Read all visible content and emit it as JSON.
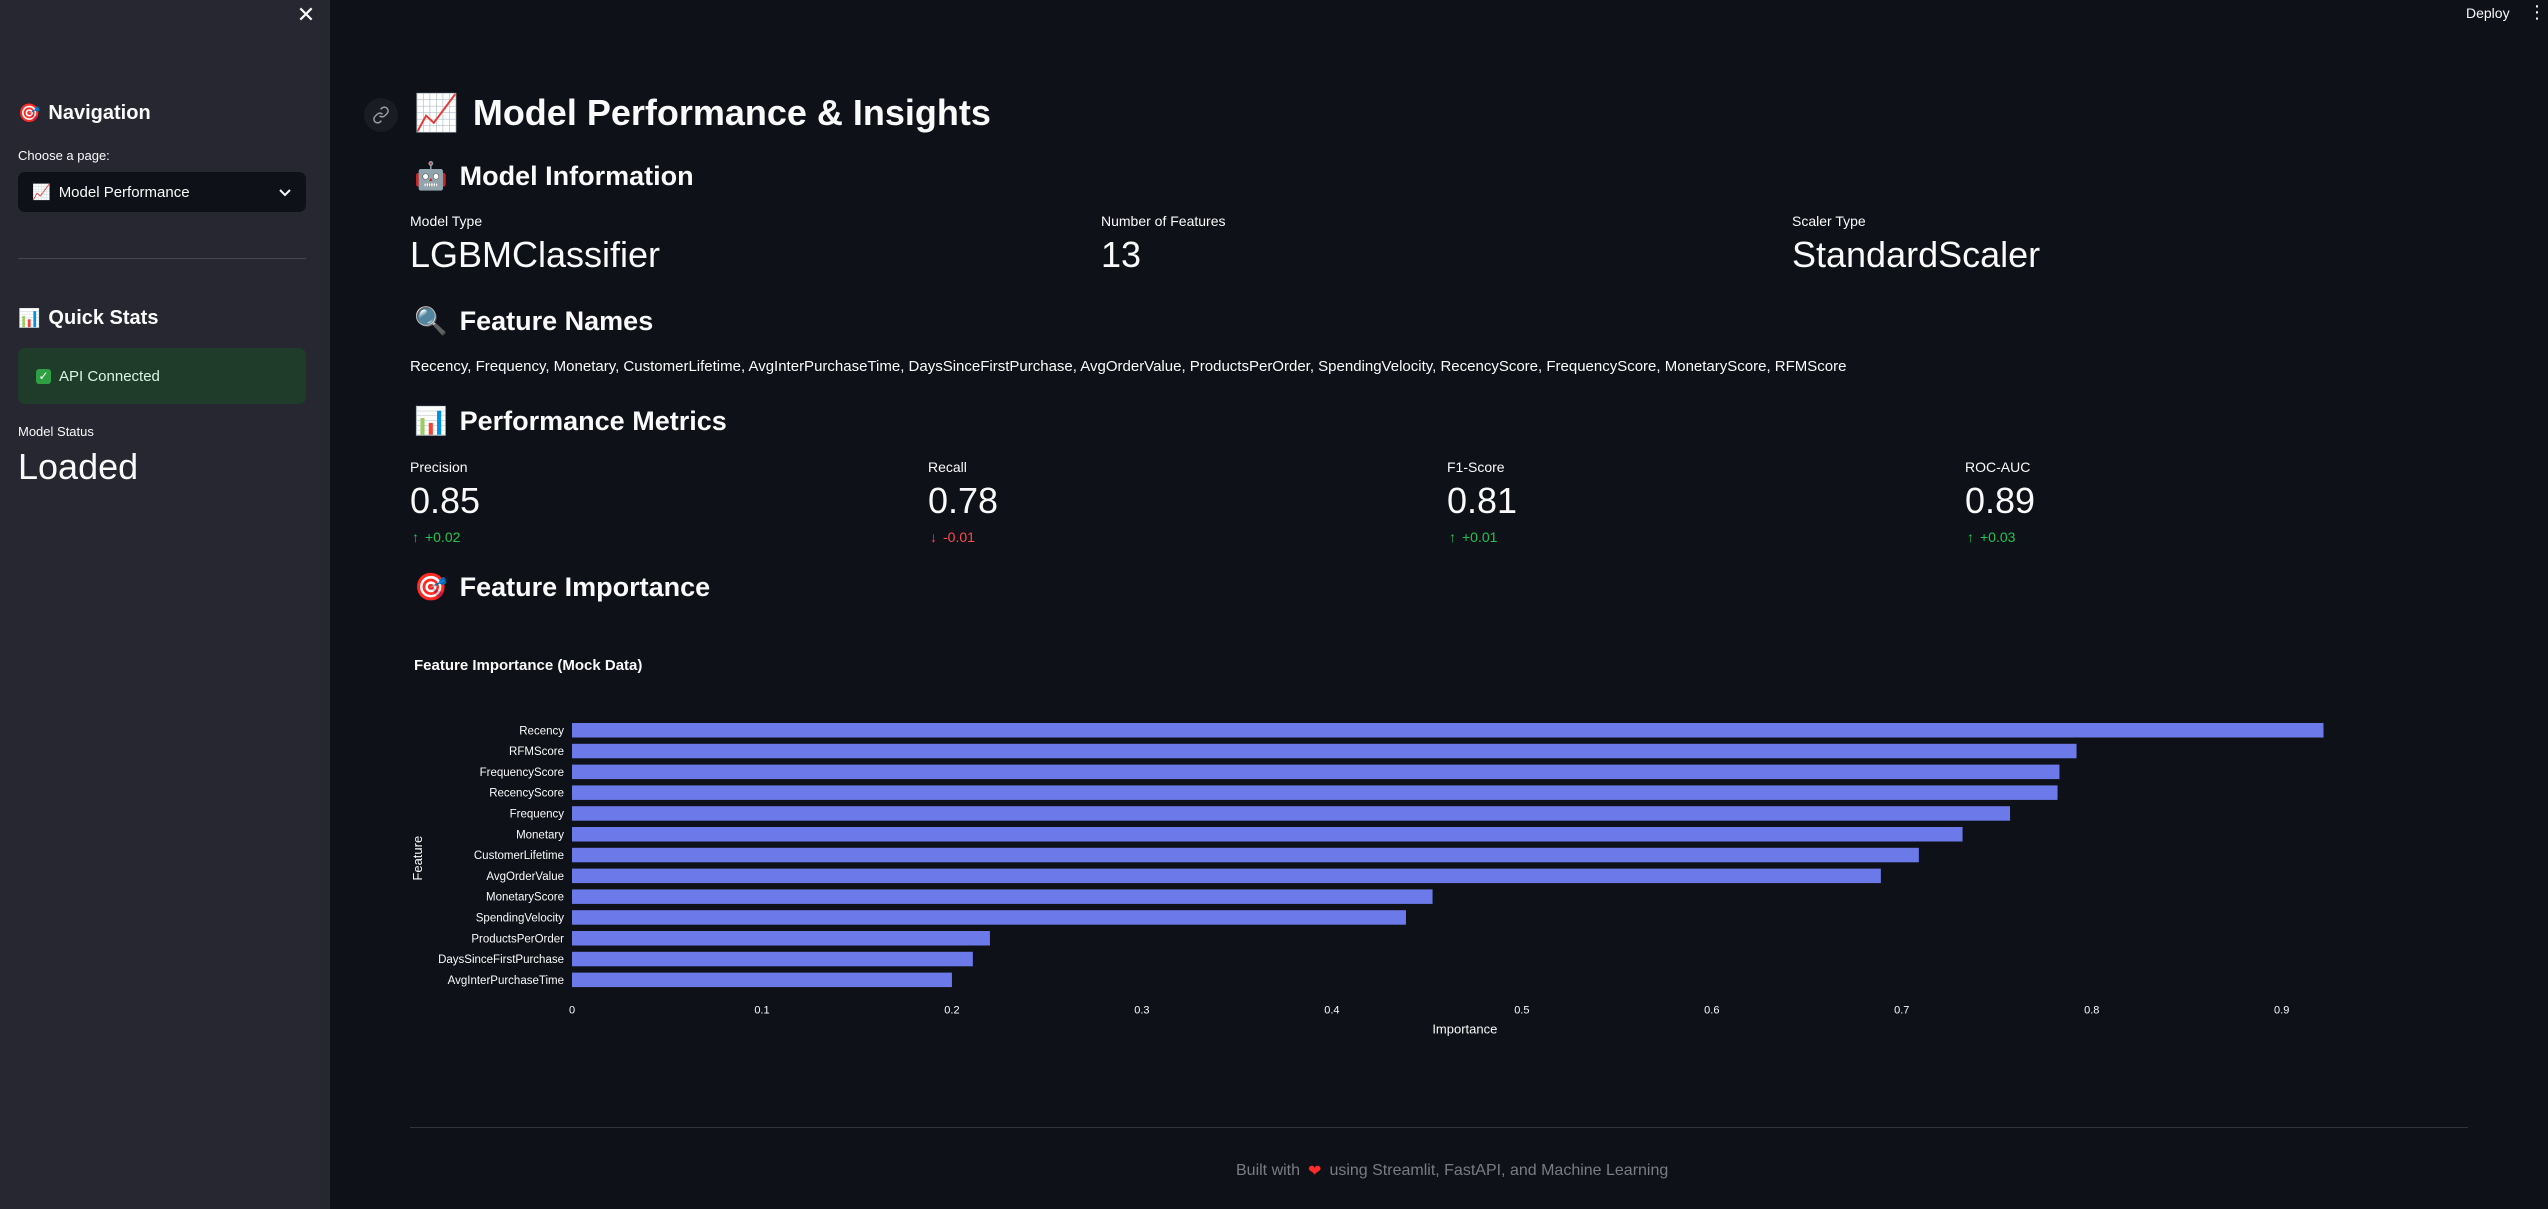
{
  "sidebar": {
    "navigation_title": "Navigation",
    "choose_label": "Choose a page:",
    "selected_page": "Model Performance",
    "quick_stats_title": "Quick Stats",
    "api_status": "API Connected",
    "model_status_label": "Model Status",
    "model_status_value": "Loaded"
  },
  "topbar": {
    "deploy_label": "Deploy"
  },
  "main": {
    "title": "Model Performance & Insights",
    "model_info": {
      "heading": "Model Information",
      "metrics": [
        {
          "label": "Model Type",
          "value": "LGBMClassifier"
        },
        {
          "label": "Number of Features",
          "value": "13"
        },
        {
          "label": "Scaler Type",
          "value": "StandardScaler"
        }
      ]
    },
    "feature_names": {
      "heading": "Feature Names",
      "text": "Recency, Frequency, Monetary, CustomerLifetime, AvgInterPurchaseTime, DaysSinceFirstPurchase, AvgOrderValue, ProductsPerOrder, SpendingVelocity, RecencyScore, FrequencyScore, MonetaryScore, RFMScore"
    },
    "performance": {
      "heading": "Performance Metrics",
      "metrics": [
        {
          "label": "Precision",
          "value": "0.85",
          "delta": "+0.02",
          "direction": "up"
        },
        {
          "label": "Recall",
          "value": "0.78",
          "delta": "-0.01",
          "direction": "down"
        },
        {
          "label": "F1-Score",
          "value": "0.81",
          "delta": "+0.01",
          "direction": "up"
        },
        {
          "label": "ROC-AUC",
          "value": "0.89",
          "delta": "+0.03",
          "direction": "up"
        }
      ]
    },
    "importance": {
      "heading": "Feature Importance"
    }
  },
  "chart_data": {
    "type": "bar",
    "orientation": "horizontal",
    "title": "Feature Importance (Mock Data)",
    "xlabel": "Importance",
    "ylabel": "Feature",
    "xlim": [
      0,
      0.94
    ],
    "xticks": [
      "0",
      "0.1",
      "0.2",
      "0.3",
      "0.4",
      "0.5",
      "0.6",
      "0.7",
      "0.8",
      "0.9"
    ],
    "categories": [
      "Recency",
      "RFMScore",
      "FrequencyScore",
      "RecencyScore",
      "Frequency",
      "Monetary",
      "CustomerLifetime",
      "AvgOrderValue",
      "MonetaryScore",
      "SpendingVelocity",
      "ProductsPerOrder",
      "DaysSinceFirstPurchase",
      "AvgInterPurchaseTime"
    ],
    "values": [
      0.922,
      0.792,
      0.783,
      0.782,
      0.757,
      0.732,
      0.709,
      0.689,
      0.453,
      0.439,
      0.22,
      0.211,
      0.2
    ],
    "bar_color": "#6b7ae8",
    "grid": false
  },
  "footer": {
    "before": "Built with",
    "after": "using Streamlit, FastAPI, and Machine Learning"
  },
  "colors": {
    "background": "#0e1117",
    "sidebar": "#262730",
    "success": "#21c354",
    "error": "#ff4b4b"
  }
}
